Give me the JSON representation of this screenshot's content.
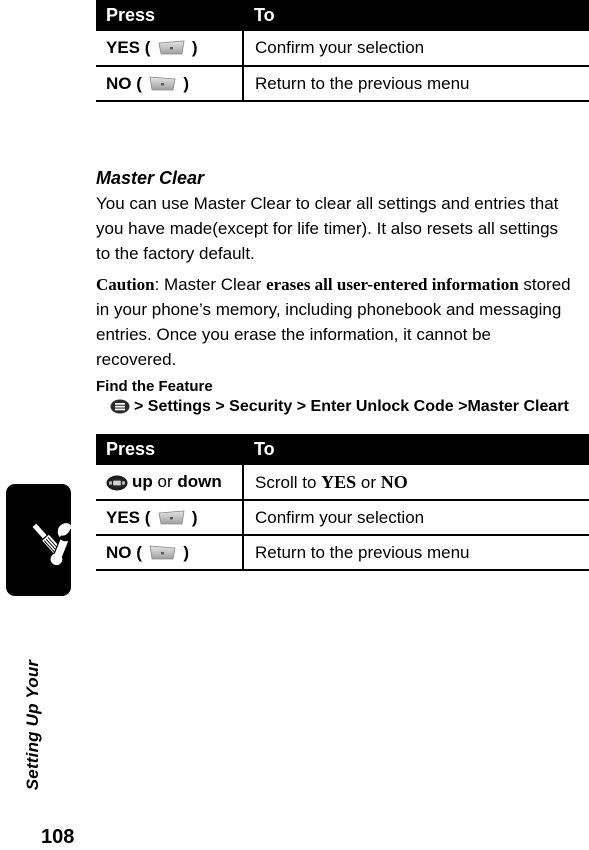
{
  "page": {
    "number": "108",
    "sidebar_label": "Setting Up Your",
    "sidebar_icon": "screwdriver-wrench-icon"
  },
  "table_top": {
    "headers": {
      "press": "Press",
      "to": "To"
    },
    "rows": [
      {
        "press_label": "YES",
        "press_icon": "right-softkey-icon",
        "press_open": "(",
        "press_close": ")",
        "to": "Confirm your selection"
      },
      {
        "press_label": "NO",
        "press_icon": "left-softkey-icon",
        "press_open": "(",
        "press_close": ")",
        "to": "Return to the previous menu"
      }
    ]
  },
  "section": {
    "title": "Master Clear",
    "paragraph_1": "You can use Master Clear to clear all settings and entries that you have made(except for life timer). It also resets all settings to the factory default.",
    "caution": {
      "word": "Caution",
      "after_word": ": Master Clear ",
      "emphasis": "erases all user-entered information",
      "rest": " stored in your phone’s memory, including phonebook and messaging entries. Once you erase the information, it cannot be recovered."
    },
    "find_the_feature": {
      "label": "Find the Feature",
      "menu_icon": "menu-list-icon",
      "path": "> Settings > Security > Enter Unlock Code >Master Cleart"
    }
  },
  "table_bottom": {
    "headers": {
      "press": "Press",
      "to": "To"
    },
    "rows": [
      {
        "press_icon": "navigation-key-icon",
        "press_up": "up",
        "press_or": " or ",
        "press_down": "down",
        "to_prefix": "Scroll to ",
        "to_yes": "YES",
        "to_or": " or ",
        "to_no": "NO"
      },
      {
        "press_label": "YES",
        "press_icon": "right-softkey-icon",
        "press_open": "(",
        "press_close": ")",
        "to": "Confirm your selection"
      },
      {
        "press_label": "NO",
        "press_icon": "left-softkey-icon",
        "press_open": "(",
        "press_close": ")",
        "to": "Return to the previous menu"
      }
    ]
  },
  "colors": {
    "header_bg": "#000000",
    "header_text": "#ffffff",
    "body_text": "#000000",
    "rule": "#000000",
    "key_gray": "#b8b8b8"
  }
}
